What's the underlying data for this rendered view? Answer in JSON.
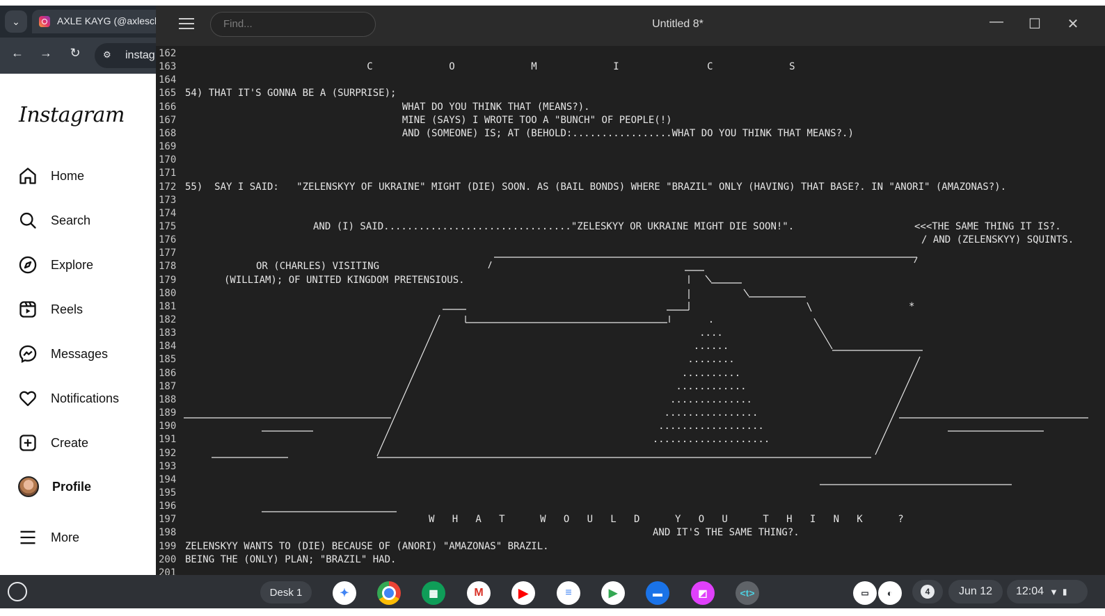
{
  "browser": {
    "tab_title": "AXLE KAYG (@axlesch",
    "omnibox_text": "instag",
    "logo": "Instagram",
    "nav": [
      {
        "label": "Home",
        "icon": "home-icon"
      },
      {
        "label": "Search",
        "icon": "search-icon"
      },
      {
        "label": "Explore",
        "icon": "compass-icon"
      },
      {
        "label": "Reels",
        "icon": "reels-icon"
      },
      {
        "label": "Messages",
        "icon": "messenger-icon"
      },
      {
        "label": "Notifications",
        "icon": "heart-icon"
      },
      {
        "label": "Create",
        "icon": "plus-square-icon"
      },
      {
        "label": "Profile",
        "icon": "avatar"
      },
      {
        "label": "More",
        "icon": "menu-icon"
      }
    ]
  },
  "editor": {
    "title": "Untitled 8*",
    "find_placeholder": "Find...",
    "line_numbers": [
      "162",
      "163",
      "164",
      "165",
      "166",
      "167",
      "168",
      "169",
      "170",
      "171",
      "172",
      "173",
      "174",
      "175",
      "176",
      "177",
      "178",
      "179",
      "180",
      "181",
      "182",
      "183",
      "184",
      "185",
      "186",
      "187",
      "188",
      "189",
      "190",
      "191",
      "192",
      "193",
      "194",
      "195",
      "196",
      "197",
      "198",
      "199",
      "200",
      "201"
    ],
    "lines": {
      "l163": "                               C             O             M             I               C             S",
      "l165": "54) THAT IT'S GONNA BE A (SURPRISE);",
      "l166": "                                     WHAT DO YOU THINK THAT (MEANS?).",
      "l167": "                                     MINE (SAYS) I WROTE TOO A \"BUNCH\" OF PEOPLE(!)",
      "l168": "                                     AND (SOMEONE) IS; AT (BEHOLD:.................WHAT DO YOU THINK THAT MEANS?.)",
      "l172": "55)  SAY I SAID:   \"ZELENSKYY OF UKRAINE\" MIGHT (DIE) SOON. AS (BAIL BONDS) WHERE \"BRAZIL\" ONLY (HAVING) THAT BASE?. IN \"ANORI\" (AMAZONAS?).",
      "l175a": "AND (I) SAID................................\"ZELESKYY OR UKRAINE MIGHT DIE SOON!\".",
      "l175b": "<<<THE SAME THING IT IS?.",
      "l176": "/ AND (ZELENSKYY) SQUINTS.",
      "l178": "OR (CHARLES) VISITING",
      "l179": "(WILLIAM); OF UNITED KINGDOM PRETENSIOUS.",
      "l181_star": "*",
      "l197": "W   H   A   T      W   O   U   L   D      Y   O   U      T   H   I   N   K      ?",
      "l198": "AND IT'S THE SAME THING?.",
      "l199": "ZELENSKYY WANTS TO (DIE) BECAUSE OF (ANORI) \"AMAZONAS\" BRAZIL.",
      "l200": "BEING THE (ONLY) PLAN; \"BRAZIL\" HAD."
    },
    "dots": [
      ".",
      "....",
      "......",
      "........",
      "..........",
      "............",
      "..............",
      "................",
      "..................",
      "...................."
    ]
  },
  "shelf": {
    "desk_label": "Desk 1",
    "notification_count": "4",
    "date": "Jun 12",
    "time": "12:04",
    "apps": [
      "gemini-icon",
      "chrome-icon",
      "app-grid-icon",
      "gmail-icon",
      "youtube-icon",
      "docs-icon",
      "play-store-icon",
      "files-icon",
      "screenshot-app-icon",
      "text-editor-icon"
    ]
  }
}
